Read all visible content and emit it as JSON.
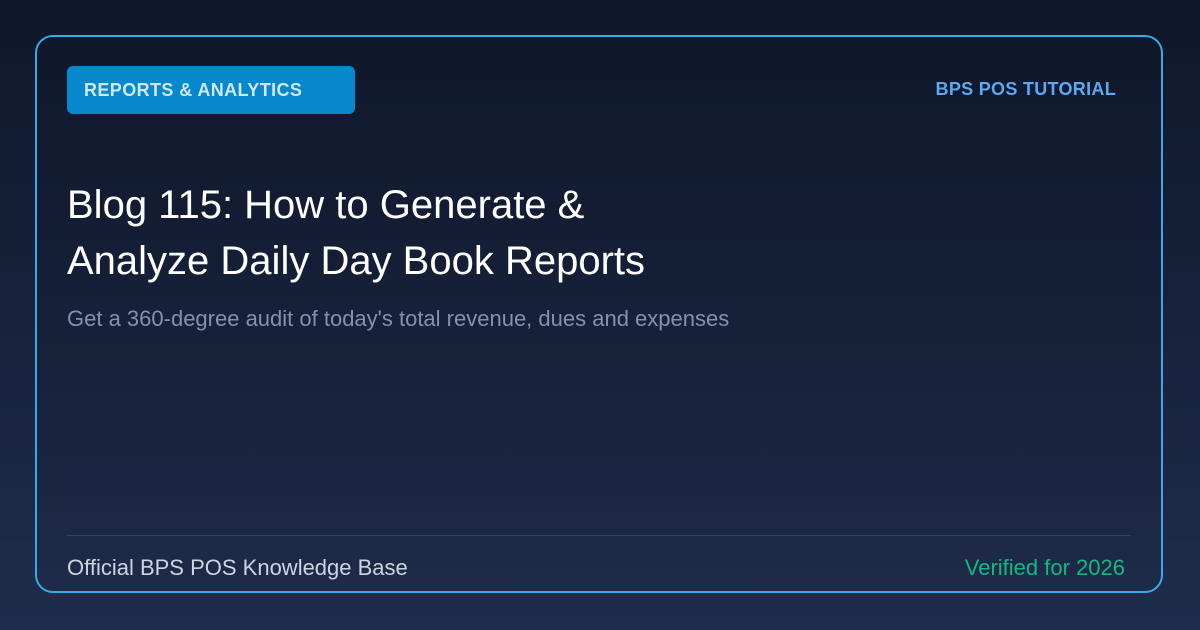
{
  "header": {
    "badge_label": "REPORTS & ANALYTICS",
    "tutorial_label": "BPS POS TUTORIAL"
  },
  "main": {
    "title_line1": "Blog 115: How to Generate &",
    "title_line2": "Analyze Daily Day Book Reports",
    "subtitle": "Get a 360-degree audit of today's total revenue, dues and expenses"
  },
  "footer": {
    "left_text": "Official BPS POS Knowledge Base",
    "right_text": "Verified for 2026"
  },
  "colors": {
    "accent_border": "#3ba9e8",
    "badge_bg": "#0788cc",
    "tutorial_text": "#5aa9f2",
    "verified_text": "#10b981"
  }
}
